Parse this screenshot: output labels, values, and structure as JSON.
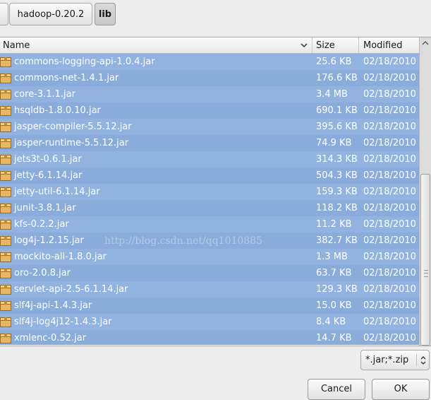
{
  "breadcrumb": {
    "items": [
      {
        "label": ""
      },
      {
        "label": "hadoop-0.20.2"
      },
      {
        "label": "lib"
      }
    ]
  },
  "columns": {
    "name": "Name",
    "size": "Size",
    "modified": "Modified"
  },
  "files": [
    {
      "name": "commons-logging-api-1.0.4.jar",
      "size": "25.6 KB",
      "modified": "02/18/2010"
    },
    {
      "name": "commons-net-1.4.1.jar",
      "size": "176.6 KB",
      "modified": "02/18/2010"
    },
    {
      "name": "core-3.1.1.jar",
      "size": "3.4 MB",
      "modified": "02/18/2010"
    },
    {
      "name": "hsqldb-1.8.0.10.jar",
      "size": "690.1 KB",
      "modified": "02/18/2010"
    },
    {
      "name": "jasper-compiler-5.5.12.jar",
      "size": "395.6 KB",
      "modified": "02/18/2010"
    },
    {
      "name": "jasper-runtime-5.5.12.jar",
      "size": "74.9 KB",
      "modified": "02/18/2010"
    },
    {
      "name": "jets3t-0.6.1.jar",
      "size": "314.3 KB",
      "modified": "02/18/2010"
    },
    {
      "name": "jetty-6.1.14.jar",
      "size": "504.3 KB",
      "modified": "02/18/2010"
    },
    {
      "name": "jetty-util-6.1.14.jar",
      "size": "159.3 KB",
      "modified": "02/18/2010"
    },
    {
      "name": "junit-3.8.1.jar",
      "size": "118.2 KB",
      "modified": "02/18/2010"
    },
    {
      "name": "kfs-0.2.2.jar",
      "size": "11.2 KB",
      "modified": "02/18/2010"
    },
    {
      "name": "log4j-1.2.15.jar",
      "size": "382.7 KB",
      "modified": "02/18/2010"
    },
    {
      "name": "mockito-all-1.8.0.jar",
      "size": "1.3 MB",
      "modified": "02/18/2010"
    },
    {
      "name": "oro-2.0.8.jar",
      "size": "63.7 KB",
      "modified": "02/18/2010"
    },
    {
      "name": "servlet-api-2.5-6.1.14.jar",
      "size": "129.3 KB",
      "modified": "02/18/2010"
    },
    {
      "name": "slf4j-api-1.4.3.jar",
      "size": "15.0 KB",
      "modified": "02/18/2010"
    },
    {
      "name": "slf4j-log4j12-1.4.3.jar",
      "size": "8.4 KB",
      "modified": "02/18/2010"
    },
    {
      "name": "xmlenc-0.52.jar",
      "size": "14.7 KB",
      "modified": "02/18/2010"
    }
  ],
  "watermark": "http://blog.csdn.net/qq1010885",
  "filter": {
    "value": "*.jar;*.zip"
  },
  "buttons": {
    "cancel": "Cancel",
    "ok": "OK"
  },
  "colors": {
    "selection": "#92b3e0",
    "window": "#ededed",
    "icon": "#e6b35a"
  }
}
